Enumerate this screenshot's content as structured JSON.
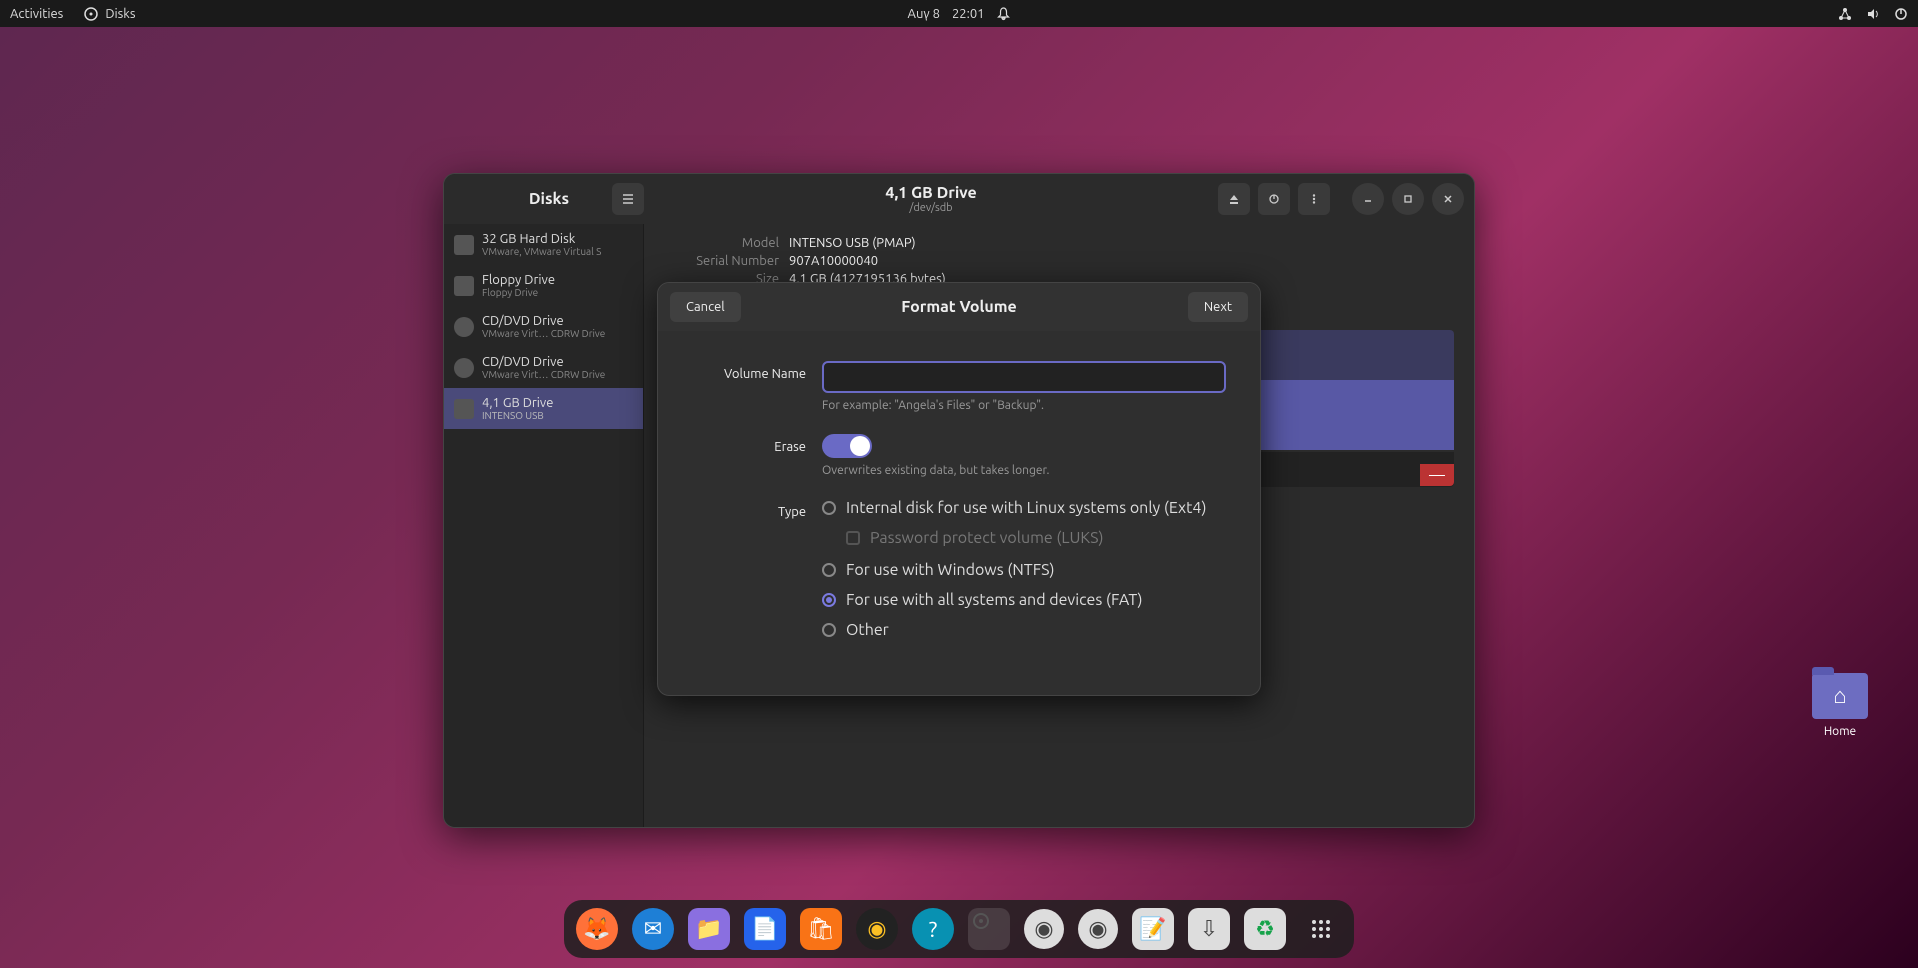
{
  "topbar": {
    "activities": "Activities",
    "app_name": "Disks",
    "date": "Auγ 8",
    "time": "22:01"
  },
  "desktop": {
    "home_label": "Home"
  },
  "window": {
    "title": "Disks",
    "header_title": "4,1 GB Drive",
    "header_sub": "/dev/sdb",
    "info": {
      "model_label": "Model",
      "model_value": "INTENSO USB (PMAP)",
      "serial_label": "Serial Number",
      "serial_value": "907A10000040",
      "size_label": "Size",
      "size_value": "4,1 GB (4127195136 bytes)"
    }
  },
  "drives": [
    {
      "title": "32 GB Hard Disk",
      "sub": "VMware, VMware Virtual S"
    },
    {
      "title": "Floppy Drive",
      "sub": "Floppy Drive"
    },
    {
      "title": "CD/DVD Drive",
      "sub": "VMware Virt…   CDRW Drive"
    },
    {
      "title": "CD/DVD Drive",
      "sub": "VMware Virt…   CDRW Drive"
    },
    {
      "title": "4,1 GB Drive",
      "sub": "INTENSO USB"
    }
  ],
  "dialog": {
    "title": "Format Volume",
    "cancel": "Cancel",
    "next": "Next",
    "volume_name_label": "Volume Name",
    "volume_name_value": "",
    "volume_name_hint": "For example: \"Angela's Files\" or \"Backup\".",
    "erase_label": "Erase",
    "erase_hint": "Overwrites existing data, but takes longer.",
    "type_label": "Type",
    "opt_ext4": "Internal disk for use with Linux systems only (Ext4)",
    "opt_luks": "Password protect volume (LUKS)",
    "opt_ntfs": "For use with Windows (NTFS)",
    "opt_fat": "For use with all systems and devices (FAT)",
    "opt_other": "Other"
  }
}
